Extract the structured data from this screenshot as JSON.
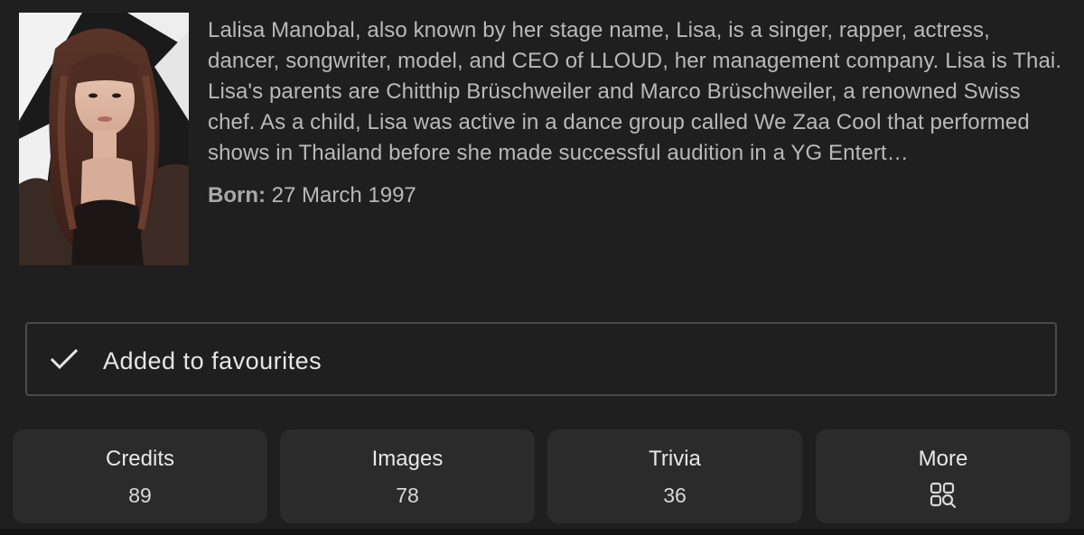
{
  "person": {
    "bio": "Lalisa Manobal, also known by her stage name, Lisa, is a singer, rapper, actress, dancer, songwriter, model, and CEO of LLOUD, her management company. Lisa is Thai. Lisa's parents are Chitthip Brüschweiler and Marco Brüschweiler, a renowned Swiss chef. As a child, Lisa was active in a dance group called We Zaa Cool that performed shows in Thailand before she made successful audition in a YG Entert…",
    "born_label": "Born:",
    "born_value": "27 March 1997"
  },
  "favourite": {
    "label": "Added to favourites",
    "icon": "checkmark-icon"
  },
  "stats": [
    {
      "title": "Credits",
      "value": "89"
    },
    {
      "title": "Images",
      "value": "78"
    },
    {
      "title": "Trivia",
      "value": "36"
    },
    {
      "title": "More",
      "icon": "grid-search-icon"
    }
  ],
  "colors": {
    "background": "#1f1f1f",
    "tile": "#2b2b2b",
    "border": "#4a4a4a",
    "text": "#b9b9b9",
    "text_bright": "#e8e8e8"
  }
}
